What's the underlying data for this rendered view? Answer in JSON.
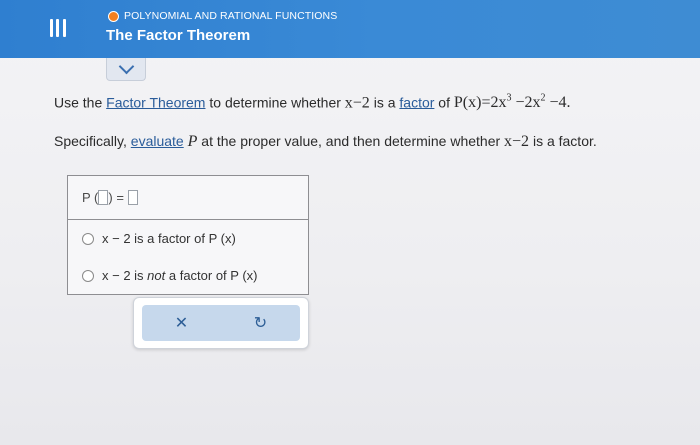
{
  "header": {
    "topic": "POLYNOMIAL AND RATIONAL FUNCTIONS",
    "title": "The Factor Theorem"
  },
  "question": {
    "line1_pre": "Use the ",
    "link_factor_theorem": "Factor Theorem",
    "line1_mid": " to determine whether ",
    "divisor": "x−2",
    "line1_mid2": " is a ",
    "link_factor": "factor",
    "line1_post": " of ",
    "poly_lhs": "P(x)",
    "poly_rhs_a": "=2x",
    "exp3": "3",
    "poly_rhs_b": " −2x",
    "exp2": "2",
    "poly_rhs_c": " −4.",
    "line2_pre": "Specifically, ",
    "link_evaluate": "evaluate",
    "line2_p": "P",
    "line2_mid": " at the proper value, and then determine whether ",
    "line2_divisor": "x−2",
    "line2_post": " is a factor."
  },
  "answer": {
    "eq_p": "P (",
    "eq_mid": ") = ",
    "option1": "x − 2 is a factor of P (x)",
    "option2_a": "x − 2 is ",
    "option2_not": "not",
    "option2_b": " a factor of P (x)"
  },
  "buttons": {
    "clear": "✕",
    "reset": "↻"
  }
}
